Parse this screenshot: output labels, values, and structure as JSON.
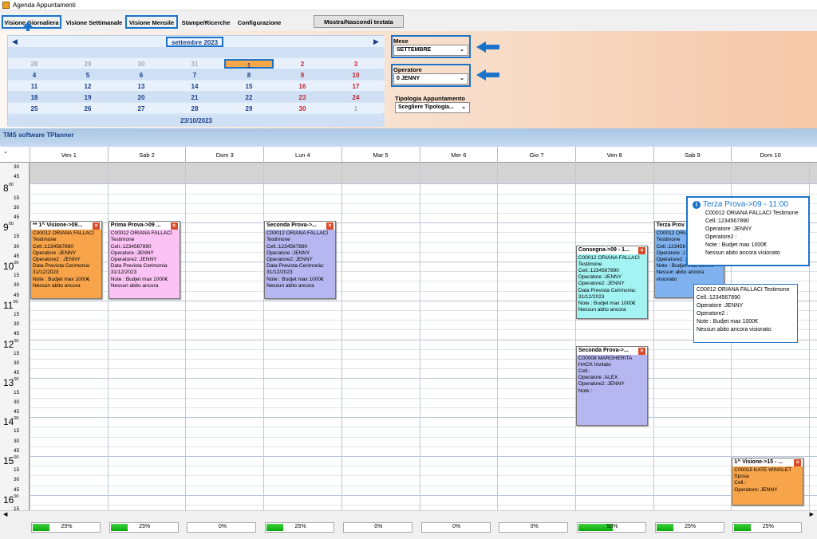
{
  "window": {
    "title": "Agenda Appuntamenti"
  },
  "tabs": [
    {
      "label": "Visione Giornaliera"
    },
    {
      "label": "Visione Settimanale"
    },
    {
      "label": "Visione Mensile"
    },
    {
      "label": "Stampe/Ricerche"
    },
    {
      "label": "Configurazione"
    }
  ],
  "header_toggle": "Mostra/Nascondi testata",
  "calendar": {
    "month": "settembre 2023",
    "weekdays": [
      "lun",
      "mar",
      "mer",
      "gio",
      "ven",
      "sab",
      "dom"
    ],
    "weeks": [
      [
        "28",
        "29",
        "30",
        "31",
        "1",
        "2",
        "3"
      ],
      [
        "4",
        "5",
        "6",
        "7",
        "8",
        "9",
        "10"
      ],
      [
        "11",
        "12",
        "13",
        "14",
        "15",
        "16",
        "17"
      ],
      [
        "18",
        "19",
        "20",
        "21",
        "22",
        "23",
        "24"
      ],
      [
        "25",
        "26",
        "27",
        "28",
        "29",
        "30",
        "1"
      ]
    ],
    "today_label": "23/10/2023"
  },
  "filters": {
    "mese_label": "Mese",
    "mese_value": "SETTEMBRE",
    "operatore_label": "Operatore",
    "operatore_value": "0 JENNY",
    "tipologia_label": "Tipologia Appuntamento",
    "tipologia_value": "Scegliere Tipologia..."
  },
  "planner": {
    "title": "TMS software TPlanner",
    "columns": [
      "Ven 1",
      "Sab 2",
      "Dom 3",
      "Lun 4",
      "Mar 5",
      "Mer 6",
      "Gio 7",
      "Ven 8",
      "Sab 9",
      "Dom 10"
    ],
    "hours": [
      "8",
      "9",
      "10",
      "11",
      "12",
      "13",
      "14",
      "15",
      "16"
    ],
    "minutes": [
      "15",
      "30",
      "45"
    ],
    "top_minutes": [
      "30",
      "45"
    ]
  },
  "appointments": [
    {
      "title": "** 1^ Visione->09...",
      "lines": [
        "C00012 ORIANA  FALLACI",
        "Testimone",
        "Cell.:1234567890",
        "Operatore :JENNY",
        "Operatore2 : JENNY",
        "Data Prevista Cerimonia:",
        "31/12/2023",
        "Note : Budjet max 1000€",
        "Nessun abito ancora"
      ],
      "color": "#f7a44a"
    },
    {
      "title": "Prima Prova->09 ...",
      "lines": [
        "C00012 ORIANA  FALLACI",
        "Testimone",
        "Cell.:1234567890",
        "Operatore :JENNY",
        "Operatore2 :JENNY",
        "Data Prevista Cerimonia:",
        "31/12/2023",
        "Note : Budjet max 1000€",
        "Nessun abito ancora"
      ],
      "color": "#fbc3f4"
    },
    {
      "title": "Seconda Prova->...",
      "lines": [
        "C00012 ORIANA  FALLACI",
        "Testimone",
        "Cell.:1234567890",
        "Operatore :JENNY",
        "Operatore2 :JENNY",
        "Data Prevista Cerimonia:",
        "31/12/2023",
        "Note : Budjet max 1000€",
        "Nessun abito ancora"
      ],
      "color": "#b6b6f0"
    },
    {
      "title": "Consegna->09 - 1...",
      "lines": [
        "C00012 ORIANA  FALLACI",
        "Testimone",
        "Cell.:1234567890",
        "Operatore :JENNY",
        "Operatore2 :JENNY",
        "Data Prevista Cerimonia:",
        "31/12/2023",
        "Note : Budjet max 1000€",
        "Nessun abito ancora"
      ],
      "color": "#a3f3f3"
    },
    {
      "title": "Terza Prov",
      "lines": [
        "C00012 ORIA",
        "Testimone",
        "Cell.:123456",
        "Operatore :J",
        "Operatore2 :J",
        "Note : Budjet max 1000€",
        "Nessun abito ancora",
        "visionato"
      ],
      "color": "#7fb2ee"
    },
    {
      "title": "Seconda Prova->...",
      "lines": [
        "C00008 MARGHERITA",
        "HACK Invitato",
        "Cell.:",
        "Operatore :ALEX",
        "Operatore2 :JENNY",
        "Note :"
      ],
      "color": "#b6b6f0"
    },
    {
      "title": "1^ Visione->15 - ...",
      "lines": [
        "C00015 KATE WINSLET",
        "Sposa",
        "Cell.:",
        "Operatore: JENNY"
      ],
      "color": "#f7a44a"
    }
  ],
  "tooltip1": {
    "title": "Terza Prova->09 - 11:00",
    "lines": [
      "C00012 ORIANA  FALLACI Testimone",
      "Cell.:1234567890",
      "Operatore :JENNY",
      "Operatore2 :",
      "Note : Budjet max 1000€",
      "Nessun abito ancora visionato"
    ]
  },
  "tooltip2": {
    "lines": [
      "C00012 ORIANA  FALLACI Testimone",
      "Cell.:1234567890",
      "Operatore :JENNY",
      "Operatore2 :",
      "Note : Budjet max 1000€",
      "Nessun abito ancora visionato"
    ]
  },
  "status": {
    "progress": [
      {
        "label": "25%",
        "value": 0.25
      },
      {
        "label": "25%",
        "value": 0.25
      },
      {
        "label": "0%",
        "value": 0
      },
      {
        "label": "25%",
        "value": 0.25
      },
      {
        "label": "0%",
        "value": 0
      },
      {
        "label": "0%",
        "value": 0
      },
      {
        "label": "0%",
        "value": 0
      },
      {
        "label": "50%",
        "value": 0.5
      },
      {
        "label": "25%",
        "value": 0.25
      },
      {
        "label": "25%",
        "value": 0.25
      }
    ]
  }
}
